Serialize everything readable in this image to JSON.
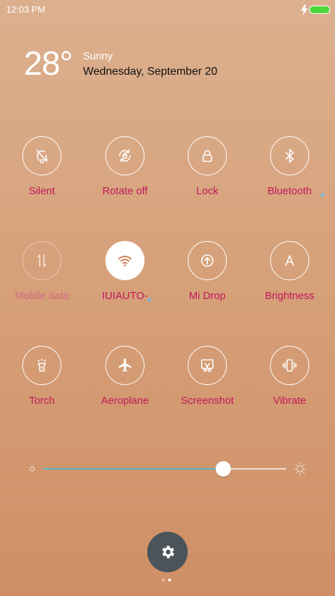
{
  "status_bar": {
    "time": "12:03 PM",
    "charging": true,
    "battery_color": "#4cd63b"
  },
  "weather": {
    "temperature": "28°",
    "condition": "Sunny",
    "date": "Wednesday, September 20"
  },
  "toggles": [
    {
      "label": "Silent",
      "icon": "bell-off-icon",
      "state": "off"
    },
    {
      "label": "Rotate off",
      "icon": "rotate-lock-icon",
      "state": "off"
    },
    {
      "label": "Lock",
      "icon": "lock-icon",
      "state": "off"
    },
    {
      "label": "Bluetooth",
      "icon": "bluetooth-icon",
      "state": "off",
      "has_more": true
    },
    {
      "label": "Mobile data",
      "icon": "mobile-data-icon",
      "state": "disabled"
    },
    {
      "label": "IUIAUTO-",
      "icon": "wifi-icon",
      "state": "on",
      "has_more": true
    },
    {
      "label": "Mi Drop",
      "icon": "mi-drop-icon",
      "state": "off"
    },
    {
      "label": "Brightness",
      "icon": "auto-brightness-icon",
      "state": "off"
    },
    {
      "label": "Torch",
      "icon": "torch-icon",
      "state": "off"
    },
    {
      "label": "Aeroplane",
      "icon": "airplane-icon",
      "state": "off"
    },
    {
      "label": "Screenshot",
      "icon": "screenshot-icon",
      "state": "off"
    },
    {
      "label": "Vibrate",
      "icon": "vibrate-icon",
      "state": "off"
    }
  ],
  "brightness": {
    "level": 0.74,
    "fill_color": "#4fb7c7"
  },
  "settings": {
    "icon": "gear-icon"
  },
  "pagination": {
    "total": 2,
    "current": 2
  },
  "colors": {
    "label": "#c2185b",
    "accent_more": "#6db6e6"
  }
}
